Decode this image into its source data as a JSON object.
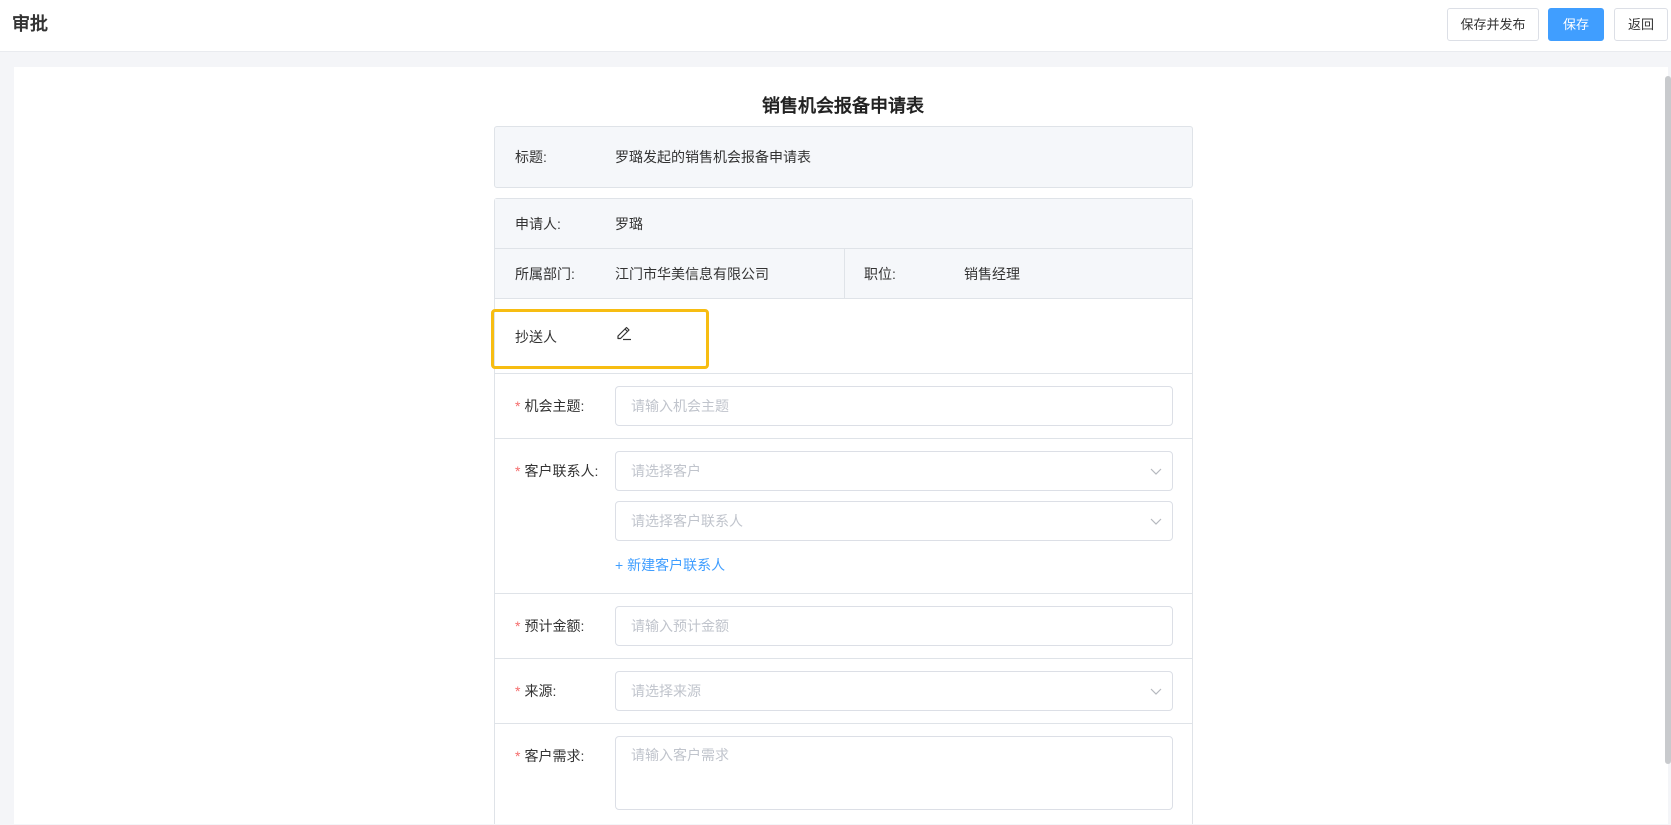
{
  "header": {
    "title": "审批",
    "buttons": {
      "save_publish": "保存并发布",
      "save": "保存",
      "back": "返回"
    }
  },
  "form": {
    "title": "销售机会报备申请表",
    "subject": {
      "label": "标题:",
      "value": "罗璐发起的销售机会报备申请表"
    },
    "applicant": {
      "label": "申请人:",
      "value": "罗璐"
    },
    "department": {
      "label": "所属部门:",
      "value": "江门市华美信息有限公司"
    },
    "position": {
      "label": "职位:",
      "value": "销售经理"
    },
    "cc": {
      "label": "抄送人",
      "icon": "pencil-icon"
    },
    "opportunity": {
      "label": "机会主题:",
      "placeholder": "请输入机会主题"
    },
    "customer_contact": {
      "label": "客户联系人:",
      "customer_placeholder": "请选择客户",
      "contact_placeholder": "请选择客户联系人",
      "add_link": "+ 新建客户联系人"
    },
    "amount": {
      "label": "预计金额:",
      "placeholder": "请输入预计金额"
    },
    "source": {
      "label": "来源:",
      "placeholder": "请选择来源"
    },
    "requirement": {
      "label": "客户需求:",
      "placeholder": "请输入客户需求"
    },
    "required_mark": "*"
  },
  "colors": {
    "primary": "#409eff",
    "highlight": "#f7bd12",
    "required": "#f56c6c"
  }
}
